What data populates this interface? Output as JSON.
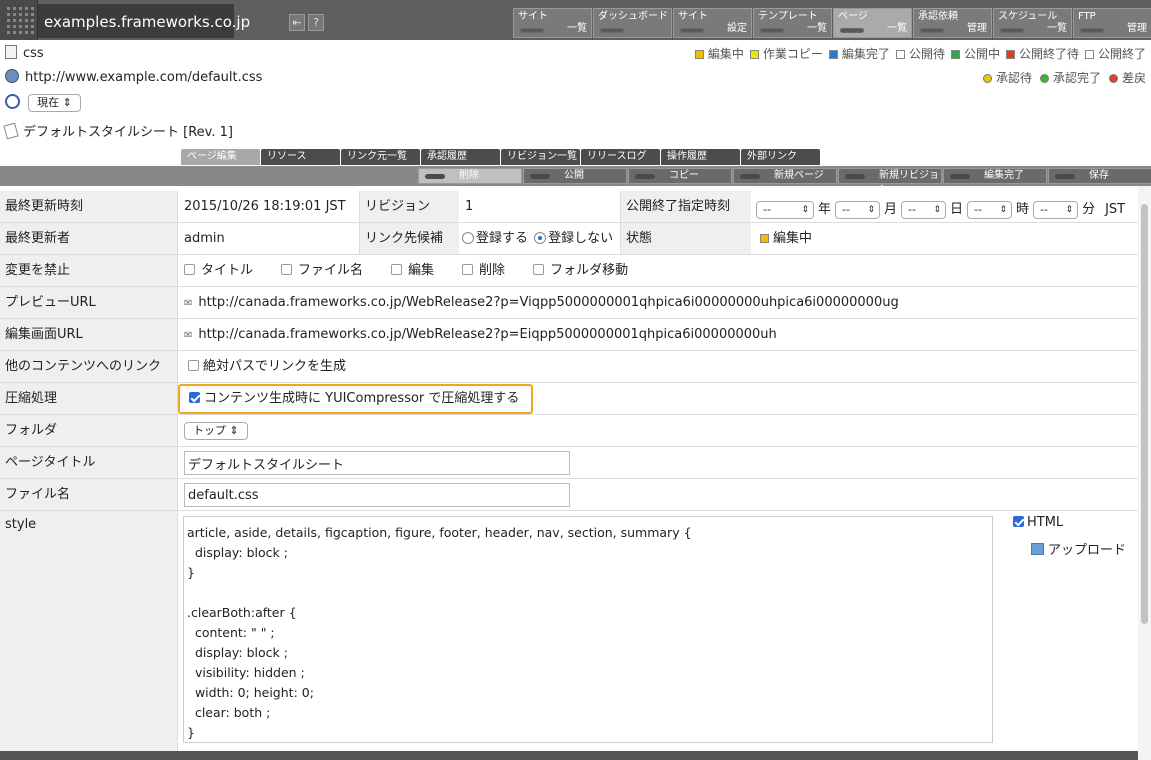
{
  "site": {
    "domain": "examples.frameworks.co.jp",
    "buttons": [
      "⇤",
      "?"
    ]
  },
  "menu": [
    {
      "top": "サイト",
      "bottom": "一覧"
    },
    {
      "top": "ダッシュボード",
      "bottom": ""
    },
    {
      "top": "サイト",
      "bottom": "設定"
    },
    {
      "top": "テンプレート",
      "bottom": "一覧"
    },
    {
      "top": "ページ",
      "bottom": "一覧",
      "active": true
    },
    {
      "top": "承認依頼",
      "bottom": "管理"
    },
    {
      "top": "スケジュール",
      "bottom": "一覧"
    },
    {
      "top": "FTP",
      "bottom": "管理"
    }
  ],
  "header": {
    "name": "css",
    "url": "http://www.example.com/default.css",
    "time_select": "現在",
    "page_title": "デフォルトスタイルシート [Rev. 1]"
  },
  "legend": {
    "statuses": [
      {
        "label": "編集中",
        "color": "#f0c000"
      },
      {
        "label": "作業コピー",
        "color": "#e8e800"
      },
      {
        "label": "編集完了",
        "color": "#1e7fd8"
      },
      {
        "label": "公開待",
        "color": "#ffffff"
      },
      {
        "label": "公開中",
        "color": "#2da84a"
      },
      {
        "label": "公開終了待",
        "color": "#e03c1c"
      },
      {
        "label": "公開終了",
        "color": "#ffffff"
      }
    ],
    "approvals": [
      {
        "label": "承認待",
        "color": "#e8c800"
      },
      {
        "label": "承認完了",
        "color": "#3cb830"
      },
      {
        "label": "差戻",
        "color": "#e04030"
      }
    ]
  },
  "tabs": [
    "ページ編集",
    "リソース",
    "リンク元一覧",
    "承認履歴",
    "リビジョン一覧",
    "リリースログ",
    "操作履歴",
    "外部リンク"
  ],
  "actions": [
    "削除",
    "公開",
    "コピー",
    "新規ページ",
    "新規リビジョン",
    "編集完了",
    "保存"
  ],
  "form": {
    "last_updated_label": "最終更新時刻",
    "last_updated": "2015/10/26 18:19:01 JST",
    "revision_label": "リビジョン",
    "revision": "1",
    "pub_end_label": "公開終了指定時刻",
    "date_placeholder": "--",
    "date_units": [
      "年",
      "月",
      "日",
      "時",
      "分"
    ],
    "tz": "JST",
    "updater_label": "最終更新者",
    "updater": "admin",
    "link_cand_label": "リンク先候補",
    "link_register": "登録する",
    "link_no_register": "登録しない",
    "state_label": "状態",
    "state": "編集中",
    "lock_label": "変更を禁止",
    "locks": [
      "タイトル",
      "ファイル名",
      "編集",
      "削除",
      "フォルダ移動"
    ],
    "preview_label": "プレビューURL",
    "preview_url": "http://canada.frameworks.co.jp/WebRelease2?p=Viqpp5000000001qhpica6i00000000uhpica6i00000000ug",
    "edit_label": "編集画面URL",
    "edit_url": "http://canada.frameworks.co.jp/WebRelease2?p=Eiqpp5000000001qhpica6i00000000uh",
    "otherlink_label": "他のコンテンツへのリンク",
    "abs_path": "絶対パスでリンクを生成",
    "compress_label": "圧縮処理",
    "compress_text": "コンテンツ生成時に YUICompressor で圧縮処理する",
    "folder_label": "フォルダ",
    "folder": "トップ",
    "pagetitle_label": "ページタイトル",
    "pagetitle": "デフォルトスタイルシート",
    "filename_label": "ファイル名",
    "filename": "default.css",
    "style_label": "style",
    "html_label": "HTML",
    "upload_label": "アップロード",
    "code": "article, aside, details, figcaption, figure, footer, header, nav, section, summary {\n  display: block ;\n}\n\n.clearBoth:after {\n  content: \" \" ;\n  display: block ;\n  visibility: hidden ;\n  width: 0; height: 0;\n  clear: both ;\n}"
  }
}
